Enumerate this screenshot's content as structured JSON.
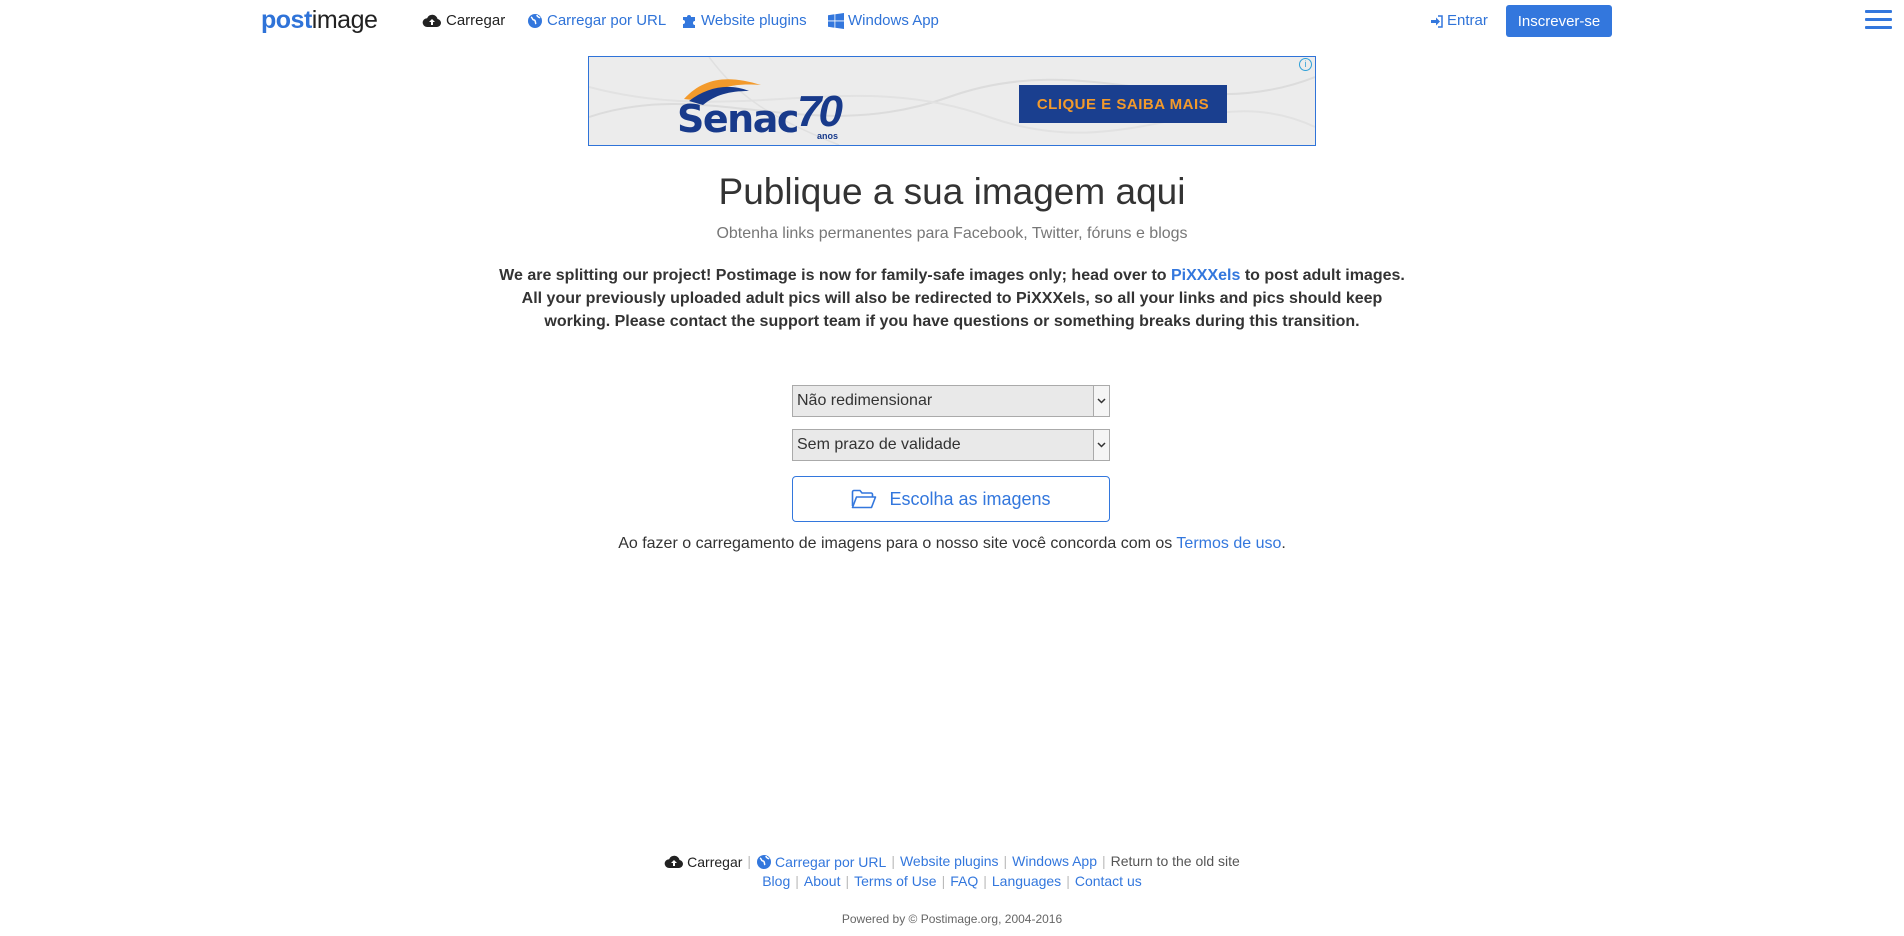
{
  "nav": {
    "logo_part1": "post",
    "logo_part2": "image",
    "upload_label": "Carregar",
    "upload_url_label": "Carregar por URL",
    "plugins_label": "Website plugins",
    "windows_label": "Windows App",
    "login_label": "Entrar",
    "signup_label": "Inscrever-se",
    "accent_color": "#3377dd"
  },
  "ad": {
    "brand": "Senac",
    "seventy": "70",
    "anos": "anos",
    "cta": "CLIQUE E SAIBA MAIS",
    "info": "i"
  },
  "main": {
    "headline": "Publique a sua imagem aqui",
    "subline": "Obtenha links permanentes para Facebook, Twitter, fóruns e blogs",
    "notice_part1": "We are splitting our project! Postimage is now for family-safe images only; head over to ",
    "notice_link": "PiXXXels",
    "notice_part2": " to post adult images. All your previously uploaded adult pics will also be redirected to PiXXXels, so all your links and pics should keep working. Please contact the support team if you have questions or something breaks during this transition.",
    "resize_select": "Não redimensionar",
    "expiry_select": "Sem prazo de validade",
    "choose_button": "Escolha as imagens",
    "terms_text": "Ao fazer o carregamento de imagens para o nosso site você concorda com os ",
    "terms_link": "Termos de uso",
    "terms_end": "."
  },
  "footer": {
    "upload": "Carregar",
    "upload_url": "Carregar por URL",
    "plugins": "Website plugins",
    "windows": "Windows App",
    "old_site": "Return to the old site",
    "blog": "Blog",
    "about": "About",
    "terms": "Terms of Use",
    "faq": "FAQ",
    "languages": "Languages",
    "contact": "Contact us",
    "powered": "Powered by © Postimage.org, 2004-2016"
  }
}
